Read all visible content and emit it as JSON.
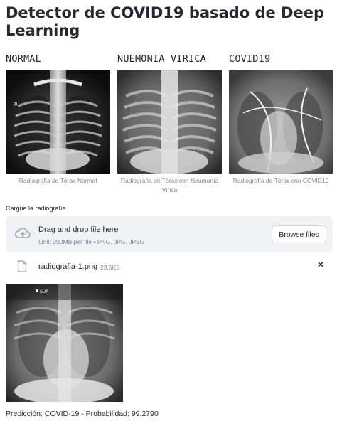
{
  "page": {
    "title": "Detector de COVID19 basado de Deep Learning"
  },
  "examples": [
    {
      "heading": "NORMAL",
      "caption": "Radiografía de Tórax Normal",
      "marker": "R"
    },
    {
      "heading": "NUEMONIA VIRICA",
      "caption": "Radiografía de Tórax con Neumonía Vírica"
    },
    {
      "heading": "COVID19",
      "caption": "Radiografía de Tórax con COVID19"
    }
  ],
  "uploader": {
    "label": "Cargue la radiografía",
    "drop_text": "Drag and drop file here",
    "limit_text": "Limit 200MB per file • PNG, JPG, JPEG",
    "browse_label": "Browse files",
    "icon": "cloud-upload-icon"
  },
  "uploaded_file": {
    "name": "radiografia-1.png",
    "size": "23.5KB",
    "icon": "file-icon",
    "remove_icon": "close-icon"
  },
  "uploaded_image": {
    "marker": "SUP"
  },
  "result": {
    "text": "Predicción: COVID-19 - Probabilidad: 99.2790"
  },
  "colors": {
    "text": "#262730",
    "muted": "#808495",
    "dropzone_bg": "#f0f2f6"
  }
}
